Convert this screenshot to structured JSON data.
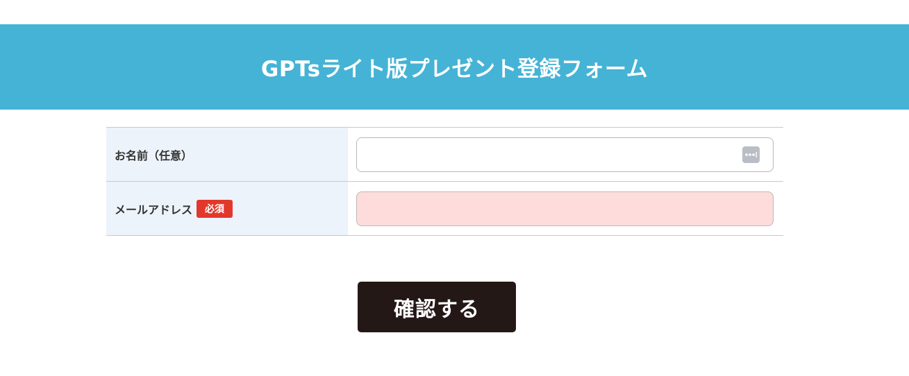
{
  "header": {
    "title": "GPTsライト版プレゼント登録フォーム"
  },
  "form": {
    "fields": [
      {
        "label": "お名前（任意）",
        "value": "",
        "placeholder": ""
      },
      {
        "label": "メールアドレス",
        "required_badge": "必須",
        "value": "",
        "placeholder": ""
      }
    ],
    "submit_label": "確認する"
  },
  "colors": {
    "header_bg": "#45b3d5",
    "label_bg": "#edf3fa",
    "required_badge_bg": "#e2382b",
    "error_input_bg": "#ffdcdc",
    "submit_bg": "#231815"
  },
  "icons": {
    "name_field_icon": "autofill-key-icon"
  }
}
